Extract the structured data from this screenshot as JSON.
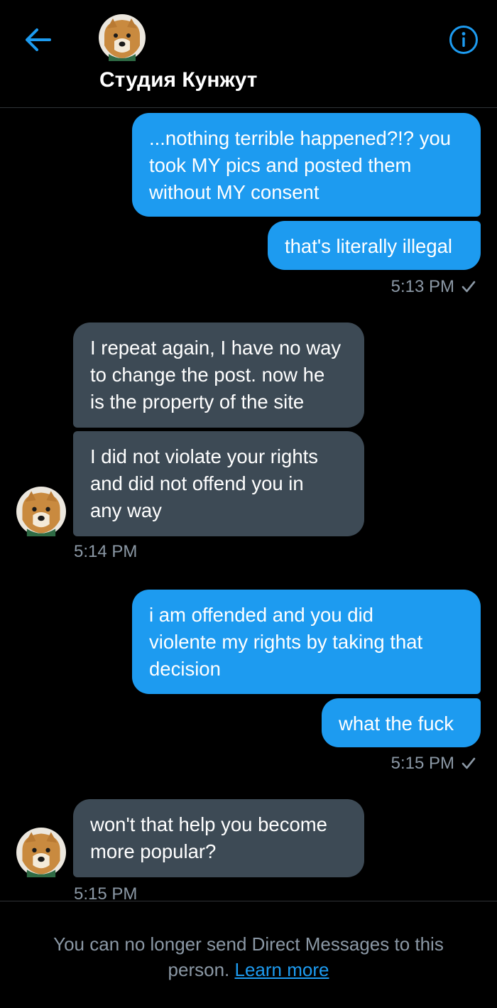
{
  "header": {
    "contact_name": "Студия Кунжут",
    "back_icon": "arrow-left-icon",
    "info_icon": "info-circle-icon",
    "accent_color": "#1d9bf0"
  },
  "messages": [
    {
      "side": "sent",
      "text": "...nothing terrible happened?!? you\ntook MY pics and posted them\nwithout MY consent"
    },
    {
      "side": "sent",
      "text": "that's literally illegal"
    },
    {
      "side": "received",
      "text": "I repeat again, I have no way\nto change the post.  now he\nis the property of the site"
    },
    {
      "side": "received",
      "text": "I did not violate your rights\nand did not offend you in\nany way"
    },
    {
      "side": "sent",
      "text": "i am offended and you did\nviolente my rights by taking that\ndecision"
    },
    {
      "side": "sent",
      "text": "what the fuck"
    },
    {
      "side": "received",
      "text": "won't that help you become\nmore popular?"
    }
  ],
  "timestamps": {
    "t1": "5:13 PM",
    "t2": "5:14 PM",
    "t3": "5:15 PM",
    "t4": "5:15 PM"
  },
  "footer": {
    "notice": "You can no longer send Direct Messages to this person.",
    "link": "Learn more"
  },
  "colors": {
    "sent_bubble": "#1d9bf0",
    "received_bubble": "#3d4a55",
    "background": "#000000",
    "muted_text": "#8b98a5"
  }
}
